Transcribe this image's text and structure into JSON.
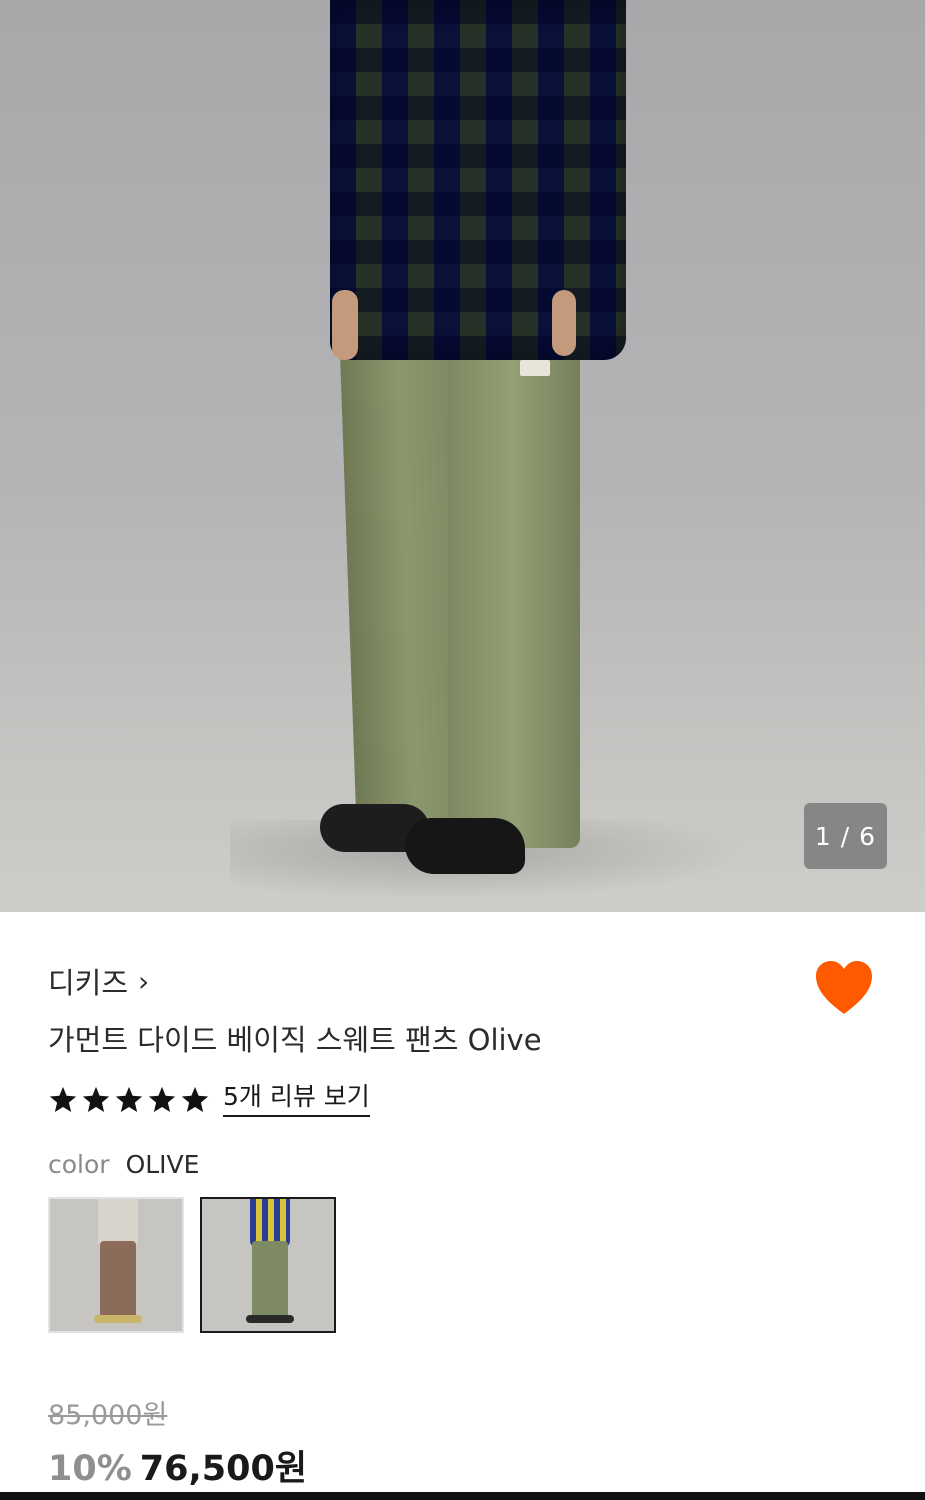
{
  "gallery": {
    "counter": "1 / 6"
  },
  "product": {
    "brand": "디키즈",
    "brand_chevron": "›",
    "title": "가먼트 다이드 베이직 스웨트 팬츠 Olive",
    "wishlisted": true,
    "wish_color": "#FF5A00",
    "rating": 5,
    "review_link": "5개 리뷰 보기",
    "color_label": "color",
    "color_value": "OLIVE",
    "color_options": [
      {
        "name": "brown",
        "selected": false
      },
      {
        "name": "olive",
        "selected": true
      }
    ],
    "original_price": "85,000원",
    "discount": "10%",
    "sale_price": "76,500원"
  }
}
